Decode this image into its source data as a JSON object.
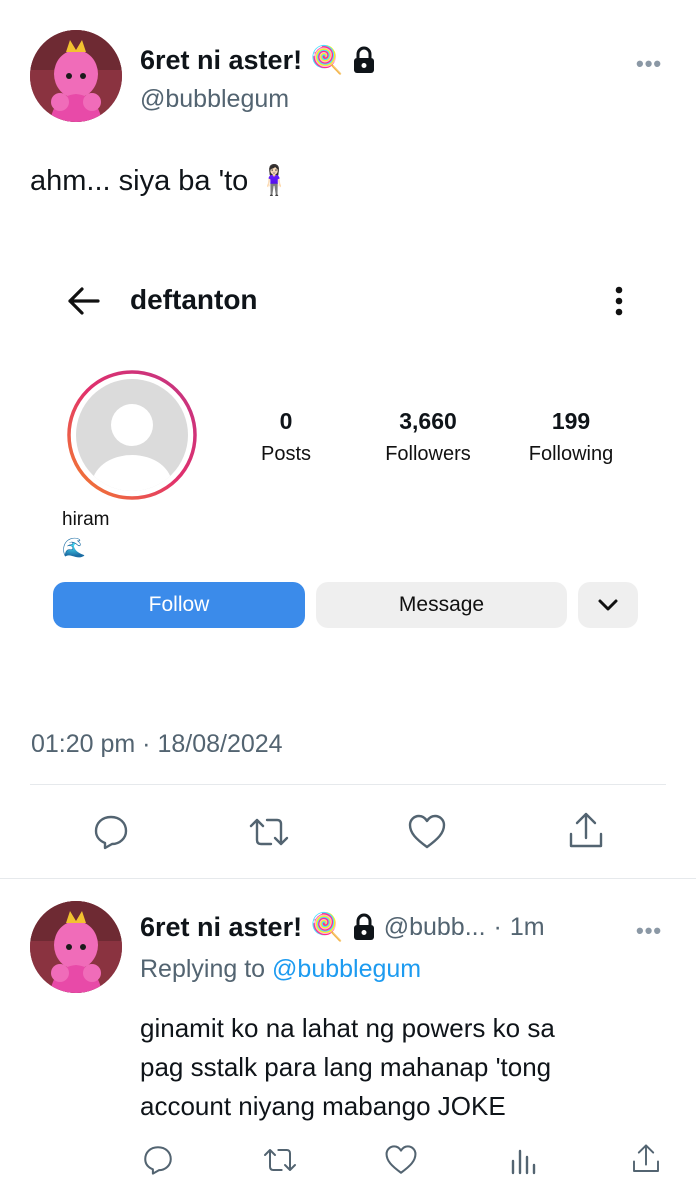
{
  "tweet": {
    "display_name": "6ret ni aster!",
    "name_emoji": "🍭",
    "lock_icon": "lock-icon",
    "handle": "@bubblegum",
    "more_label": "•••",
    "text": "ahm... siya ba 'to 🧍🏻‍♀️",
    "timestamp": "01:20 pm · 18/08/2024"
  },
  "embedded_profile": {
    "username": "deftanton",
    "stats": [
      {
        "value": "0",
        "label": "Posts"
      },
      {
        "value": "3,660",
        "label": "Followers"
      },
      {
        "value": "199",
        "label": "Following"
      }
    ],
    "bio_name": "hiram",
    "bio_emoji": "🌊",
    "follow_label": "Follow",
    "message_label": "Message"
  },
  "reply": {
    "display_name": "6ret ni aster!",
    "name_emoji": "🍭",
    "handle_trunc": "@bubb...",
    "separator": "·",
    "time": "1m",
    "more_label": "•••",
    "replying_prefix": "Replying to",
    "replying_to": "@bubblegum",
    "lines": [
      "ginamit ko na lahat ng powers ko sa",
      "pag sstalk para lang mahanap 'tong",
      "account niyang mabango JOKE"
    ]
  },
  "colors": {
    "text": "#0f1419",
    "secondary": "#536471",
    "link": "#1d9bf0",
    "follow_button": "#3b8bea",
    "ig_ring_start": "#c13584",
    "ig_ring_end": "#f58529"
  }
}
